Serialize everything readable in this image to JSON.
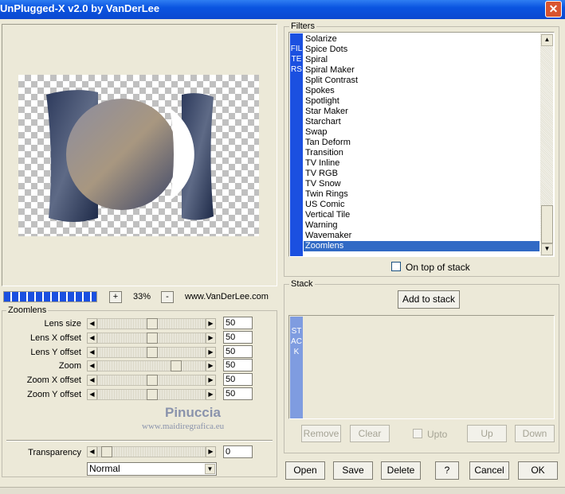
{
  "window": {
    "title": "UnPlugged-X v2.0 by VanDerLee"
  },
  "filters": {
    "group_label": "Filters",
    "side_label": "FILTERS",
    "items": [
      "Solarize",
      "Spice Dots",
      "Spiral",
      "Spiral Maker",
      "Split Contrast",
      "Spokes",
      "Spotlight",
      "Star Maker",
      "Starchart",
      "Swap",
      "Tan Deform",
      "Transition",
      "TV Inline",
      "TV RGB",
      "TV Snow",
      "Twin Rings",
      "US Comic",
      "Vertical Tile",
      "Warning",
      "Wavemaker",
      "Zoomlens"
    ],
    "selected": "Zoomlens",
    "on_top_label": "On top of stack",
    "on_top_checked": false
  },
  "zoom": {
    "minus": "-",
    "plus": "+",
    "value": "33%",
    "site": "www.VanDerLee.com"
  },
  "zoomlens": {
    "group_label": "Zoomlens",
    "params": [
      {
        "label": "Lens size",
        "value": "50"
      },
      {
        "label": "Lens X offset",
        "value": "50"
      },
      {
        "label": "Lens Y offset",
        "value": "50"
      },
      {
        "label": "Zoom",
        "value": "50"
      },
      {
        "label": "Zoom X offset",
        "value": "50"
      },
      {
        "label": "Zoom Y offset",
        "value": "50"
      }
    ]
  },
  "watermark": {
    "name": "Pinuccia",
    "url": "www.maidiregrafica.eu"
  },
  "transparency": {
    "label": "Transparency",
    "value": "0"
  },
  "blend": {
    "selected": "Normal"
  },
  "stack": {
    "group_label": "Stack",
    "add_label": "Add to stack",
    "side_label": "STACK",
    "remove_label": "Remove",
    "clear_label": "Clear",
    "upto_label": "Upto",
    "up_label": "Up",
    "down_label": "Down"
  },
  "footer": {
    "open": "Open",
    "save": "Save",
    "delete": "Delete",
    "help": "?",
    "cancel": "Cancel",
    "ok": "OK"
  },
  "colors": {
    "titlebar": "#0a54e0",
    "selection": "#316ac5",
    "filters_bar": "#1b50e0",
    "stack_bar": "#7f9ce0"
  }
}
